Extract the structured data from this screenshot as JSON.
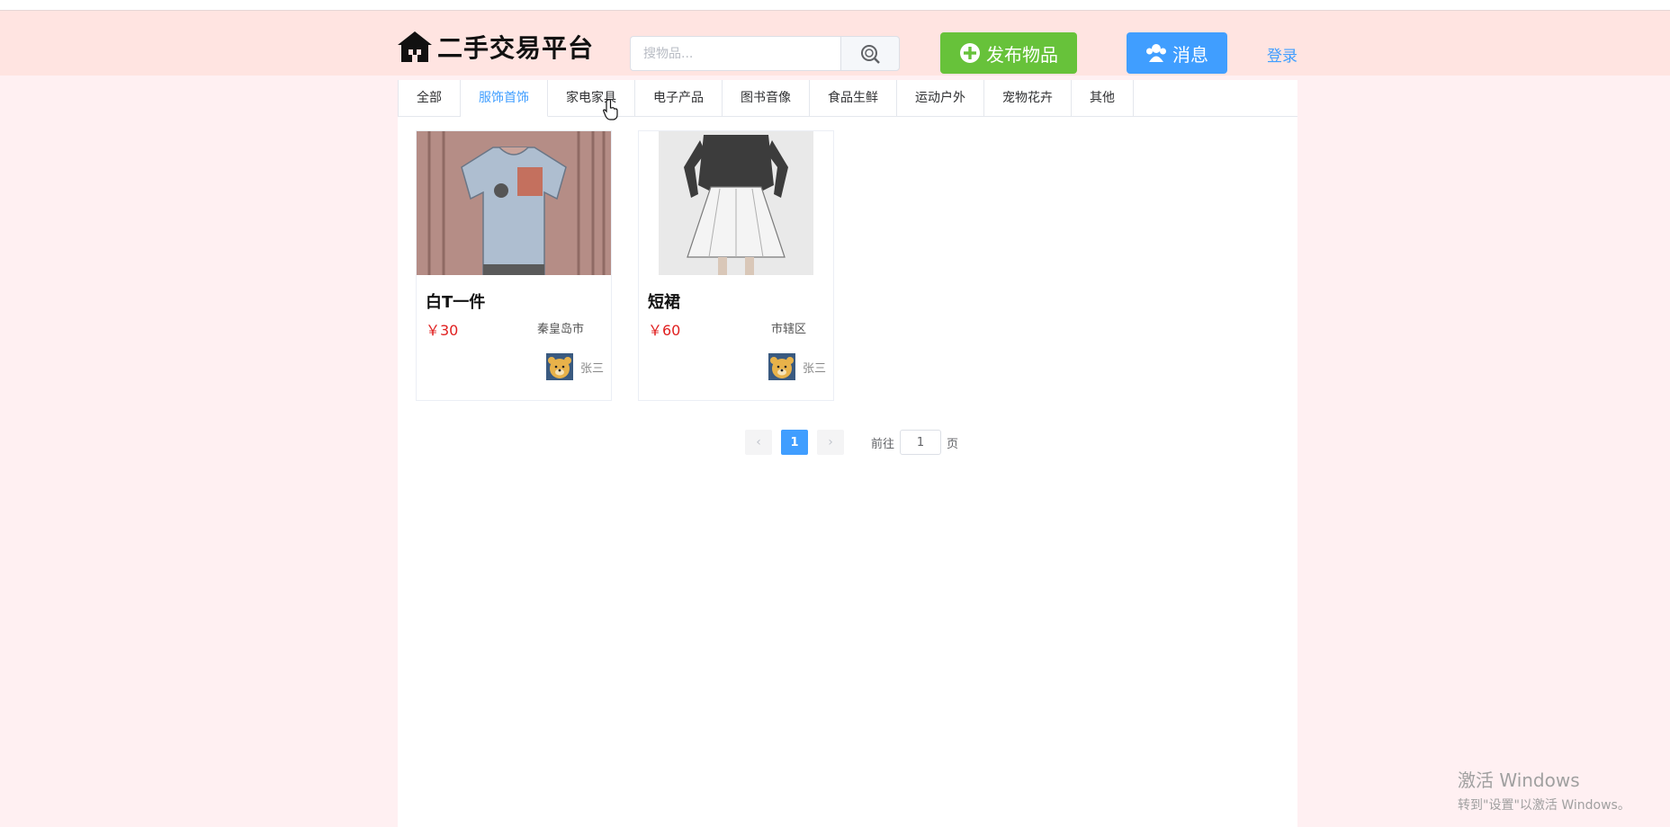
{
  "header": {
    "logo_text": "二手交易平台",
    "search_placeholder": "搜物品...",
    "publish_label": "发布物品",
    "message_label": "消息",
    "login_label": "登录"
  },
  "colors": {
    "header_bg": "#ffe4e1",
    "publish": "#67c23a",
    "message": "#409eff",
    "price": "#e02020"
  },
  "tabs": [
    {
      "label": "全部"
    },
    {
      "label": "服饰首饰",
      "active": true
    },
    {
      "label": "家电家具"
    },
    {
      "label": "电子产品"
    },
    {
      "label": "图书音像"
    },
    {
      "label": "食品生鲜"
    },
    {
      "label": "运动户外"
    },
    {
      "label": "宠物花卉"
    },
    {
      "label": "其他"
    }
  ],
  "products": [
    {
      "title": "白T一件",
      "price": "￥30",
      "location": "秦皇岛市",
      "user": "张三"
    },
    {
      "title": "短裙",
      "price": "￥60",
      "location": "市辖区",
      "user": "张三"
    }
  ],
  "pagination": {
    "current": "1",
    "goto_prefix": "前往",
    "goto_value": "1",
    "goto_suffix": "页"
  },
  "watermark": {
    "line1": "激活 Windows",
    "line2": "转到\"设置\"以激活 Windows。"
  }
}
